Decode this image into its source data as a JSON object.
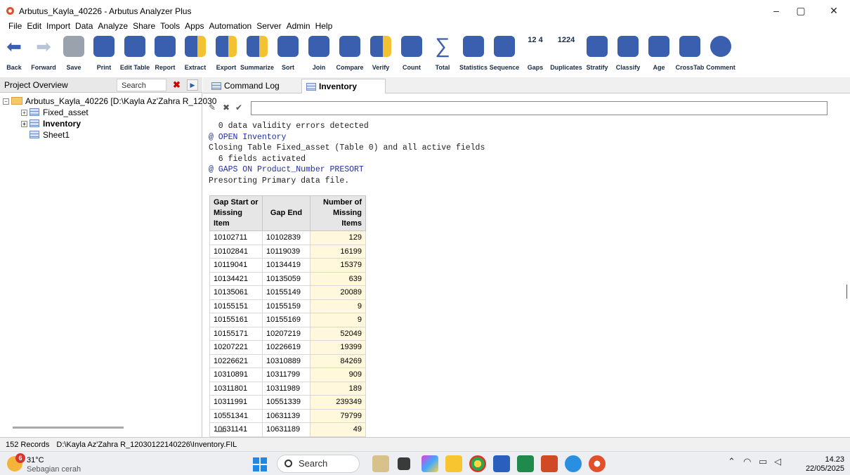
{
  "window": {
    "title": "Arbutus_Kayla_40226 - Arbutus Analyzer Plus",
    "controls": [
      "–",
      "▢",
      "✕"
    ]
  },
  "menu": [
    "File",
    "Edit",
    "Import",
    "Data",
    "Analyze",
    "Share",
    "Tools",
    "Apps",
    "Automation",
    "Server",
    "Admin",
    "Help"
  ],
  "toolbar": [
    {
      "label": "Back",
      "icon": "back-arrow-icon"
    },
    {
      "label": "Forward",
      "icon": "forward-arrow-icon"
    },
    {
      "label": "Save",
      "icon": "save-icon"
    },
    {
      "label": "Print",
      "icon": "print-icon"
    },
    {
      "label": "Edit Table",
      "icon": "edit-table-icon"
    },
    {
      "label": "Report",
      "icon": "report-icon"
    },
    {
      "label": "Extract",
      "icon": "extract-icon"
    },
    {
      "label": "Export",
      "icon": "export-icon"
    },
    {
      "label": "Summarize",
      "icon": "summarize-icon"
    },
    {
      "label": "Sort",
      "icon": "sort-icon"
    },
    {
      "label": "Join",
      "icon": "join-icon"
    },
    {
      "label": "Compare",
      "icon": "compare-icon"
    },
    {
      "label": "Verify",
      "icon": "verify-icon"
    },
    {
      "label": "Count",
      "icon": "count-icon"
    },
    {
      "label": "Total",
      "icon": "total-sigma-icon"
    },
    {
      "label": "Statistics",
      "icon": "statistics-icon"
    },
    {
      "label": "Sequence",
      "icon": "sequence-icon"
    },
    {
      "label": "Gaps",
      "icon": "gaps-icon",
      "glyph": "12 4"
    },
    {
      "label": "Duplicates",
      "icon": "duplicates-icon",
      "glyph": "1224"
    },
    {
      "label": "Stratify",
      "icon": "stratify-icon"
    },
    {
      "label": "Classify",
      "icon": "classify-icon"
    },
    {
      "label": "Age",
      "icon": "age-icon"
    },
    {
      "label": "CrossTab",
      "icon": "crosstab-icon"
    },
    {
      "label": "Comment",
      "icon": "comment-icon"
    }
  ],
  "project": {
    "header": "Project Overview",
    "search_placeholder": "Search",
    "root": "Arbutus_Kayla_40226 [D:\\Kayla Az'Zahra R_12030",
    "items": [
      "Fixed_asset",
      "Inventory",
      "Sheet1"
    ]
  },
  "tabs": [
    "Command Log",
    "Inventory"
  ],
  "log": {
    "lines": [
      {
        "text": "  0 data validity errors detected",
        "cmd": false
      },
      {
        "text": "@ OPEN Inventory",
        "cmd": true
      },
      {
        "text": "Closing Table Fixed_asset (Table 0) and all active fields",
        "cmd": false
      },
      {
        "text": "  6 fields activated",
        "cmd": false
      },
      {
        "text": "@ GAPS ON Product_Number PRESORT",
        "cmd": true
      },
      {
        "text": "Presorting Primary data file.",
        "cmd": false
      }
    ]
  },
  "gaps_table": {
    "headers": [
      "Gap Start or Missing Item",
      "Gap End",
      "Number of Missing Items"
    ],
    "rows": [
      [
        "10102711",
        "10102839",
        "129"
      ],
      [
        "10102841",
        "10119039",
        "16199"
      ],
      [
        "10119041",
        "10134419",
        "15379"
      ],
      [
        "10134421",
        "10135059",
        "639"
      ],
      [
        "10135061",
        "10155149",
        "20089"
      ],
      [
        "10155151",
        "10155159",
        "9"
      ],
      [
        "10155161",
        "10155169",
        "9"
      ],
      [
        "10155171",
        "10207219",
        "52049"
      ],
      [
        "10207221",
        "10226619",
        "19399"
      ],
      [
        "10226621",
        "10310889",
        "84269"
      ],
      [
        "10310891",
        "10311799",
        "909"
      ],
      [
        "10311801",
        "10311989",
        "189"
      ],
      [
        "10311991",
        "10551339",
        "239349"
      ],
      [
        "10551341",
        "10631139",
        "79799"
      ],
      [
        "10631141",
        "10631189",
        "49"
      ]
    ]
  },
  "status": {
    "records": "152 Records",
    "path": "D:\\Kayla Az'Zahra R_12030122140226\\Inventory.FIL"
  },
  "taskbar": {
    "weather_badge": "6",
    "temp": "31°C",
    "weather_desc": "Sebagian cerah",
    "search": "Search",
    "time": "14.23",
    "date": "22/05/2025"
  },
  "colors": {
    "toolbar_icon": "#3a5fae",
    "toolbar_accent": "#f2c233",
    "log_command": "#1f2ea6",
    "count_column": "#fff8dd"
  }
}
